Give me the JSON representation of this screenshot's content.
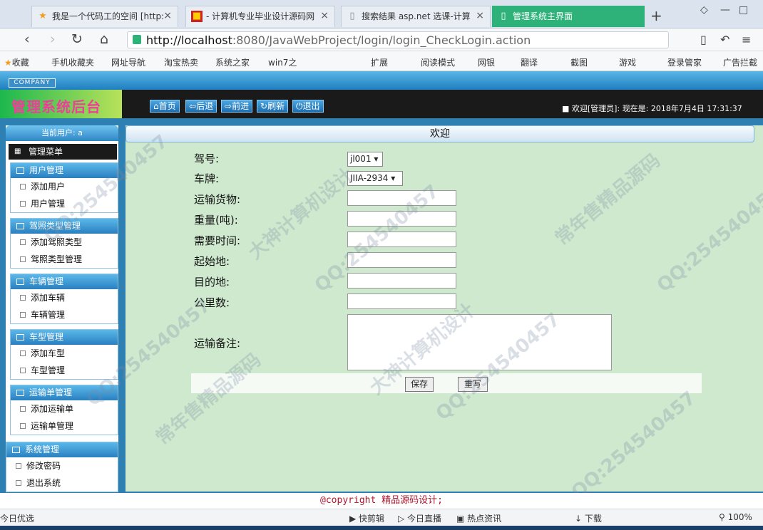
{
  "browser": {
    "tabs": [
      {
        "label": "我是一个代码工的空间 [http:",
        "icon": "star-icon"
      },
      {
        "label": "- 计算机专业毕业设计源码网",
        "icon": "site-icon"
      },
      {
        "label": "搜索结果 asp.net 选课-计算",
        "icon": "page-icon"
      },
      {
        "label": "管理系统主界面",
        "icon": "page-icon",
        "active": true
      }
    ],
    "url_host": "http://localhost",
    "url_rest": ":8080/JavaWebProject/login/login_CheckLogin.action",
    "bookmarks": [
      "收藏",
      "手机收藏夹",
      "网址导航",
      "淘宝热卖",
      "系统之家",
      "win7之"
    ],
    "toolbar_right": [
      "扩展",
      "阅读模式",
      "网银",
      "翻译",
      "截图",
      "游戏",
      "登录管家",
      "广告拦截"
    ]
  },
  "app": {
    "company": "COMPANY",
    "title": "管理系统后台",
    "nav": [
      "首页",
      "后退",
      "前进",
      "刷新",
      "退出"
    ],
    "welcome": "欢迎[管理员]:",
    "now_label": "现在是:",
    "now_value": "2018年7月4日 17:31:37",
    "current_user": "当前用户: a",
    "menu_title": "管理菜单",
    "menu_groups": [
      {
        "title": "用户管理",
        "items": [
          "添加用户",
          "用户管理"
        ]
      },
      {
        "title": "驾照类型管理",
        "items": [
          "添加驾照类型",
          "驾照类型管理"
        ]
      },
      {
        "title": "车辆管理",
        "items": [
          "添加车辆",
          "车辆管理"
        ]
      },
      {
        "title": "车型管理",
        "items": [
          "添加车型",
          "车型管理"
        ]
      },
      {
        "title": "运输单管理",
        "items": [
          "添加运输单",
          "运输单管理"
        ]
      },
      {
        "title": "系统管理",
        "items": [
          "修改密码",
          "退出系统"
        ]
      }
    ],
    "page_title": "欢迎",
    "form": {
      "driver_label": "驾号:",
      "driver_value": "jl001",
      "plate_label": "车牌:",
      "plate_value": "JIIA-2934",
      "goods_label": "运输货物:",
      "weight_label": "重量(吨):",
      "time_label": "需要时间:",
      "origin_label": "起始地:",
      "dest_label": "目的地:",
      "km_label": "公里数:",
      "remark_label": "运输备注:",
      "save": "保存",
      "reset": "重写"
    },
    "copyright": "@copyright 精品源码设计;"
  },
  "statusbar": {
    "left": "今日优选",
    "items": [
      "快剪辑",
      "今日直播",
      "热点资讯",
      "下载",
      "100%"
    ]
  },
  "watermarks": [
    "QQ:254540457",
    "大神计算机设计",
    "常年售精品源码"
  ]
}
